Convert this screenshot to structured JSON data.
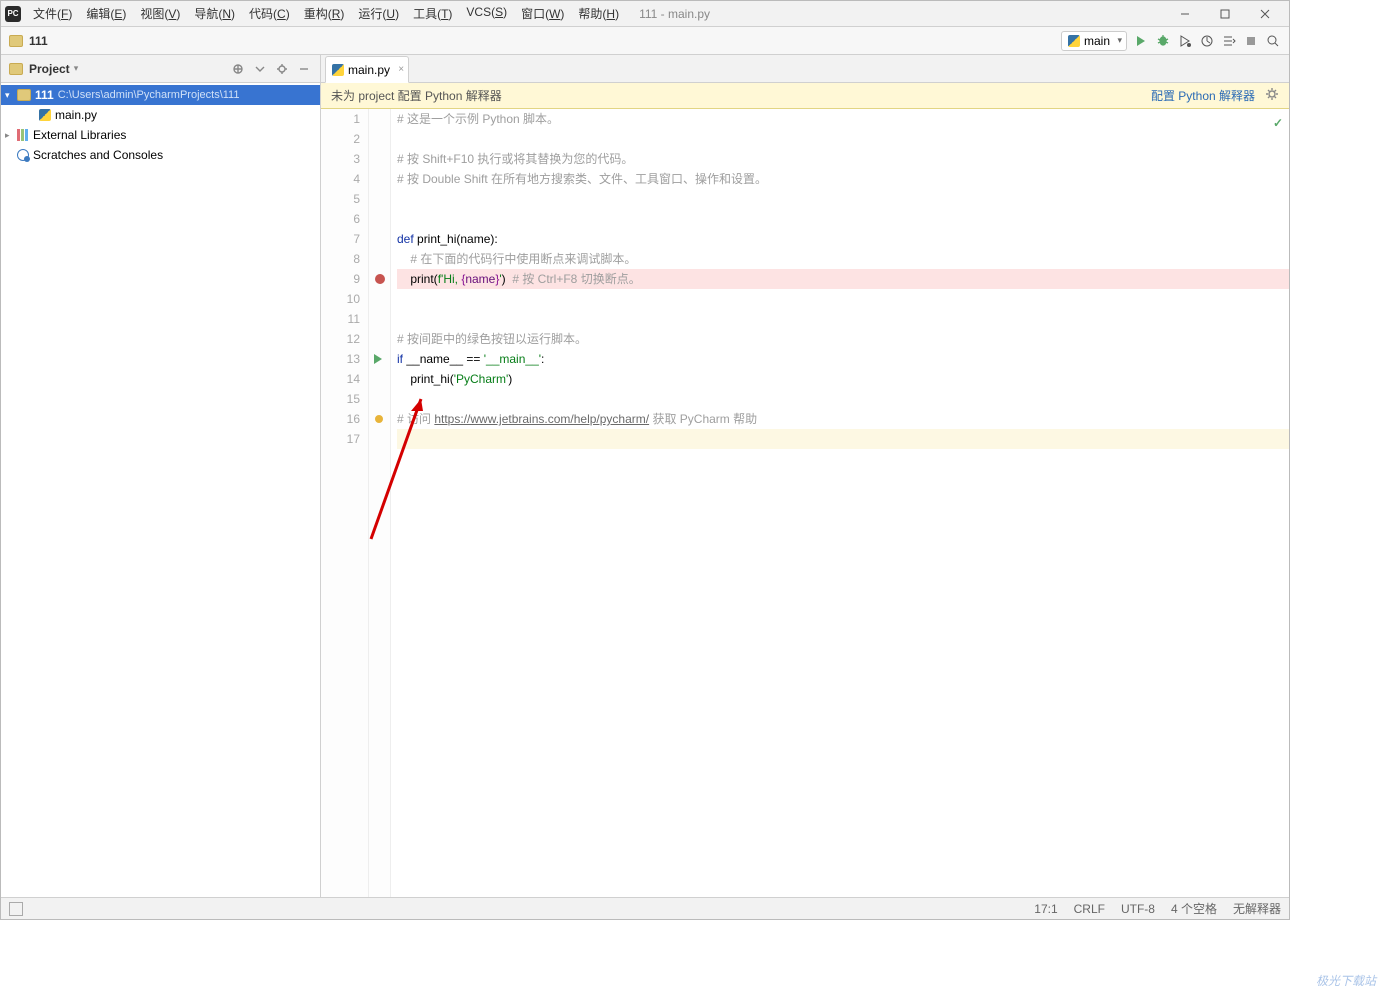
{
  "window": {
    "title": "111 - main.py"
  },
  "menu": [
    {
      "label": "文件",
      "u": "F"
    },
    {
      "label": "编辑",
      "u": "E"
    },
    {
      "label": "视图",
      "u": "V"
    },
    {
      "label": "导航",
      "u": "N"
    },
    {
      "label": "代码",
      "u": "C"
    },
    {
      "label": "重构",
      "u": "R"
    },
    {
      "label": "运行",
      "u": "U"
    },
    {
      "label": "工具",
      "u": "T"
    },
    {
      "label": "VCS",
      "u": "S"
    },
    {
      "label": "窗口",
      "u": "W"
    },
    {
      "label": "帮助",
      "u": "H"
    }
  ],
  "breadcrumb": {
    "project": "111"
  },
  "runConfig": "main",
  "project": {
    "panelTitle": "Project",
    "root": {
      "name": "111",
      "path": "C:\\Users\\admin\\PycharmProjects\\111"
    },
    "file": "main.py",
    "externalLibs": "External Libraries",
    "scratches": "Scratches and Consoles"
  },
  "tab": {
    "label": "main.py"
  },
  "notice": {
    "text": "未为 project 配置 Python 解释器",
    "link": "配置 Python 解释器"
  },
  "code": {
    "lines": [
      {
        "n": 1,
        "seg": [
          {
            "t": "# 这是一个示例 Python 脚本。",
            "cls": "c-comment"
          }
        ]
      },
      {
        "n": 2,
        "seg": []
      },
      {
        "n": 3,
        "seg": [
          {
            "t": "# 按 Shift+F10 执行或将其替换为您的代码。",
            "cls": "c-comment"
          }
        ]
      },
      {
        "n": 4,
        "seg": [
          {
            "t": "# 按 Double Shift 在所有地方搜索类、文件、工具窗口、操作和设置。",
            "cls": "c-comment"
          }
        ]
      },
      {
        "n": 5,
        "seg": []
      },
      {
        "n": 6,
        "seg": []
      },
      {
        "n": 7,
        "seg": [
          {
            "t": "def ",
            "cls": "c-kw"
          },
          {
            "t": "print_hi",
            "cls": "c-fn"
          },
          {
            "t": "(name):",
            "cls": ""
          }
        ]
      },
      {
        "n": 8,
        "seg": [
          {
            "t": "    # 在下面的代码行中使用断点来调试脚本。",
            "cls": "c-comment"
          }
        ]
      },
      {
        "n": 9,
        "hl": "red",
        "seg": [
          {
            "t": "    print(",
            "cls": ""
          },
          {
            "t": "f'Hi, ",
            "cls": "c-str"
          },
          {
            "t": "{",
            "cls": "c-spec"
          },
          {
            "t": "name",
            "cls": "c-var"
          },
          {
            "t": "}",
            "cls": "c-spec"
          },
          {
            "t": "'",
            "cls": "c-str"
          },
          {
            "t": ")  ",
            "cls": ""
          },
          {
            "t": "# 按 Ctrl+F8 切换断点。",
            "cls": "c-comment"
          }
        ]
      },
      {
        "n": 10,
        "seg": []
      },
      {
        "n": 11,
        "seg": []
      },
      {
        "n": 12,
        "seg": [
          {
            "t": "# 按间距中的绿色按钮以运行脚本。",
            "cls": "c-comment"
          }
        ]
      },
      {
        "n": 13,
        "seg": [
          {
            "t": "if ",
            "cls": "c-kw"
          },
          {
            "t": "__name__ == ",
            "cls": ""
          },
          {
            "t": "'__main__'",
            "cls": "c-str"
          },
          {
            "t": ":",
            "cls": ""
          }
        ]
      },
      {
        "n": 14,
        "seg": [
          {
            "t": "    print_hi(",
            "cls": ""
          },
          {
            "t": "'PyCharm'",
            "cls": "c-str"
          },
          {
            "t": ")",
            "cls": ""
          }
        ]
      },
      {
        "n": 15,
        "seg": []
      },
      {
        "n": 16,
        "seg": [
          {
            "t": "# 访问 ",
            "cls": "c-comment"
          },
          {
            "t": "https://www.jetbrains.com/help/pycharm/",
            "cls": "c-url"
          },
          {
            "t": " 获取 PyCharm 帮助",
            "cls": "c-comment"
          }
        ]
      },
      {
        "n": 17,
        "hl": "yellow",
        "seg": []
      }
    ],
    "breakpointLine": 9,
    "runGlyphLine": 13,
    "yellowDotLine": 16
  },
  "status": {
    "pos": "17:1",
    "eol": "CRLF",
    "enc": "UTF-8",
    "indent": "4 个空格",
    "warn": "无解释器"
  },
  "watermark": "极光下载站"
}
